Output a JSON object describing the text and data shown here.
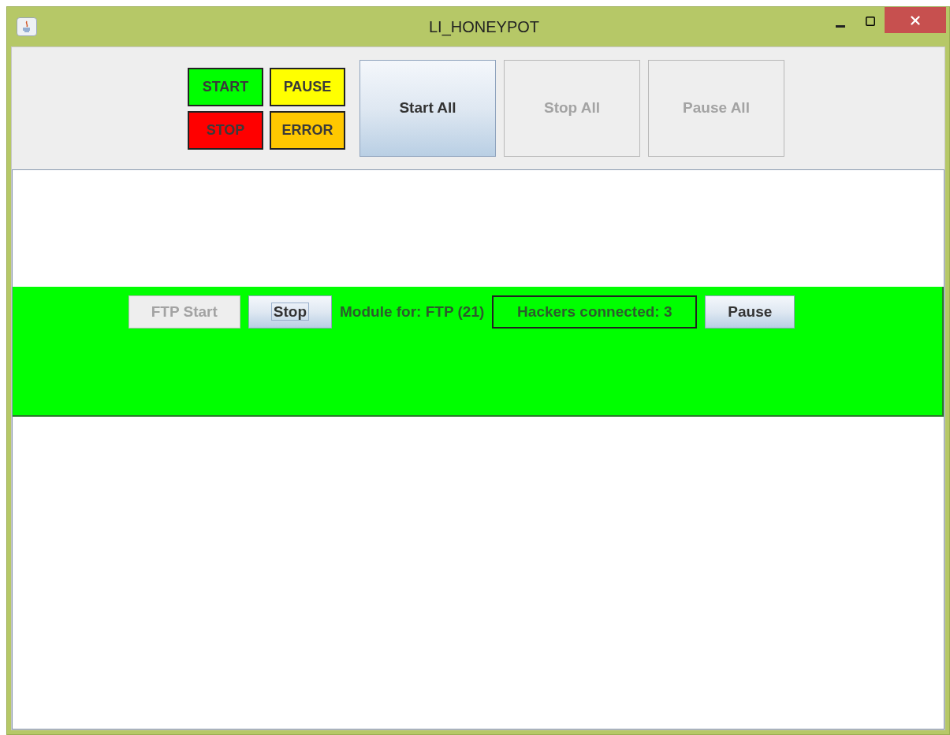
{
  "window": {
    "title": "LI_HONEYPOT"
  },
  "legend": [
    {
      "label": "START",
      "color": "#00ff00"
    },
    {
      "label": "PAUSE",
      "color": "#ffff00"
    },
    {
      "label": "STOP",
      "color": "#ff0000"
    },
    {
      "label": "ERROR",
      "color": "#ffc800"
    }
  ],
  "toolbar_buttons": [
    {
      "label": "Start All",
      "disabled": false
    },
    {
      "label": "Stop All",
      "disabled": true
    },
    {
      "label": "Pause All",
      "disabled": true
    }
  ],
  "module": {
    "color": "#00ff00",
    "buttons_before": [
      {
        "label": "FTP Start",
        "disabled": true,
        "focused": false
      },
      {
        "label": "Stop",
        "disabled": false,
        "focused": true
      }
    ],
    "description": "Module for: FTP (21)",
    "hackers": "Hackers connected: 3",
    "buttons_after": [
      {
        "label": "Pause",
        "disabled": false,
        "focused": false
      }
    ]
  }
}
